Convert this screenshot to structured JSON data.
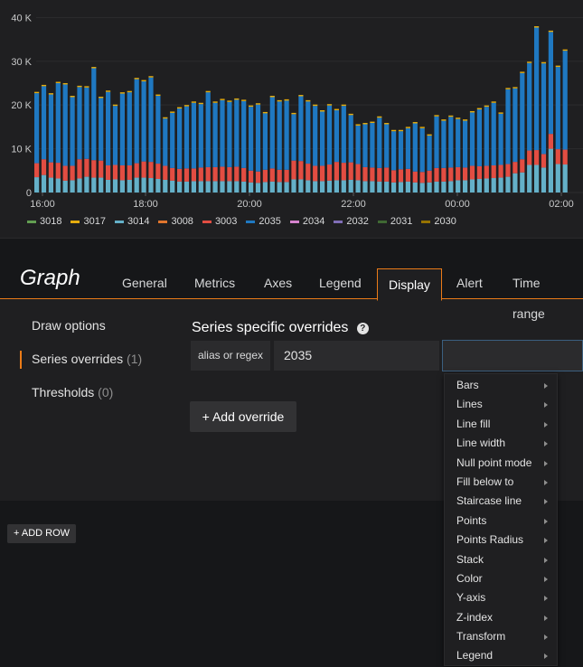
{
  "chart_data": {
    "type": "bar",
    "stacked": true,
    "y_ticks": [
      "40 K",
      "30 K",
      "20 K",
      "10 K",
      "0"
    ],
    "ylim": [
      0,
      44000
    ],
    "x_ticks": [
      "16:00",
      "18:00",
      "20:00",
      "22:00",
      "00:00",
      "02:00"
    ],
    "grid": true,
    "series": [
      {
        "name": "3018",
        "color": "#629e51"
      },
      {
        "name": "3017",
        "color": "#e5ac0e"
      },
      {
        "name": "3014",
        "color": "#64b0c8",
        "values": [
          3500,
          4000,
          3400,
          3200,
          2700,
          2800,
          3200,
          3600,
          3400,
          3400,
          2900,
          3000,
          2800,
          2900,
          3400,
          3400,
          3300,
          3100,
          2900,
          2700,
          2500,
          2500,
          2600,
          2600,
          2600,
          2600,
          2600,
          2600,
          2600,
          2500,
          2300,
          2200,
          2400,
          2500,
          2400,
          2400,
          3000,
          3000,
          2800,
          2600,
          2600,
          2700,
          2800,
          2800,
          2900,
          2800,
          2600,
          2600,
          2500,
          2500,
          2300,
          2400,
          2500,
          2300,
          2200,
          2300,
          2500,
          2500,
          2600,
          2800,
          2800,
          3000,
          3100,
          3200,
          3300,
          3400,
          3600,
          4400,
          4600,
          6300,
          6300,
          5700,
          10000,
          6500,
          6400
        ]
      },
      {
        "name": "3008",
        "color": "#e0752d"
      },
      {
        "name": "3003",
        "color": "#e24d42",
        "values": [
          3200,
          3600,
          3500,
          3600,
          3400,
          3300,
          4400,
          4100,
          4000,
          3900,
          3300,
          3300,
          3400,
          3300,
          3300,
          3700,
          3700,
          3500,
          3200,
          2900,
          2900,
          3000,
          2900,
          3100,
          3200,
          3200,
          3300,
          3200,
          3300,
          3100,
          2700,
          2600,
          2800,
          3000,
          2800,
          2800,
          4300,
          4200,
          3800,
          3500,
          3500,
          3700,
          4200,
          4000,
          4000,
          3700,
          3200,
          3100,
          3100,
          3200,
          2800,
          2900,
          2900,
          2500,
          2500,
          2700,
          3100,
          3100,
          3100,
          3000,
          2900,
          3100,
          2900,
          2900,
          2900,
          2900,
          2900,
          2600,
          3000,
          3300,
          3400,
          3100,
          3400,
          3400,
          3400
        ]
      },
      {
        "name": "2035",
        "color": "#1f78c1",
        "values": [
          16000,
          16700,
          15500,
          18200,
          18600,
          15700,
          16500,
          16300,
          21000,
          14300,
          16800,
          13500,
          16400,
          16700,
          19200,
          18300,
          19300,
          15500,
          10800,
          12600,
          13800,
          14200,
          15000,
          14500,
          17100,
          14700,
          15200,
          14900,
          15300,
          15300,
          14600,
          15300,
          12900,
          16300,
          15600,
          15800,
          10600,
          14800,
          14200,
          13700,
          12400,
          13500,
          11800,
          13000,
          10800,
          8800,
          9800,
          10200,
          11500,
          9900,
          8900,
          8700,
          9300,
          11000,
          10000,
          8000,
          11800,
          10800,
          11600,
          11000,
          10700,
          12200,
          13000,
          13500,
          14300,
          11700,
          17100,
          16800,
          19700,
          20000,
          28000,
          20700,
          23300,
          18800,
          22600
        ]
      },
      {
        "name": "2034",
        "color": "#d683ce"
      },
      {
        "name": "2032",
        "color": "#806eb7"
      },
      {
        "name": "2031",
        "color": "#3f6833"
      },
      {
        "name": "2030",
        "color": "#967302"
      }
    ]
  },
  "editor": {
    "panel_title": "Graph",
    "tabs": [
      "General",
      "Metrics",
      "Axes",
      "Legend",
      "Display",
      "Alert",
      "Time range"
    ],
    "active_tab": "Display",
    "side_nav": [
      {
        "label": "Draw options",
        "count": ""
      },
      {
        "label": "Series overrides",
        "count": "(1)"
      },
      {
        "label": "Thresholds",
        "count": "(0)"
      }
    ],
    "overrides_title": "Series specific overrides",
    "help_glyph": "?",
    "alias_label": "alias or regex",
    "alias_value": "2035",
    "add_override_label": "+ Add override",
    "add_row_label": "+ ADD ROW",
    "menu_items": [
      "Bars",
      "Lines",
      "Line fill",
      "Line width",
      "Null point mode",
      "Fill below to",
      "Staircase line",
      "Points",
      "Points Radius",
      "Stack",
      "Color",
      "Y-axis",
      "Z-index",
      "Transform",
      "Legend"
    ]
  }
}
